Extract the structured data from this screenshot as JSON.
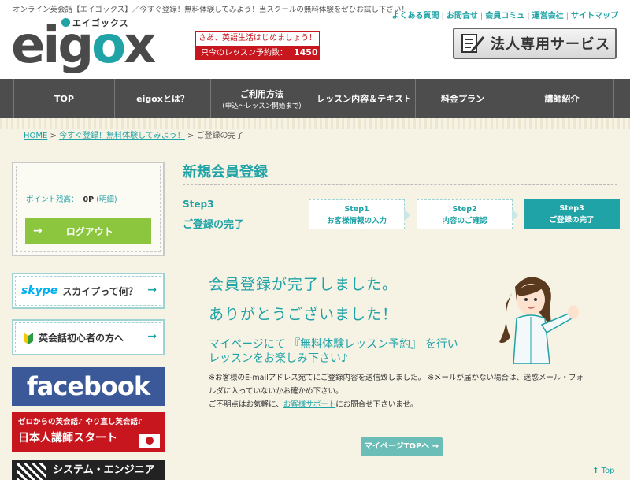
{
  "header": {
    "tagline": "オンライン英会話【エイゴックス】／今すぐ登録！無料体験してみよう！当スクールの無料体験をぜひお試し下さい！",
    "logo_kana": "エイゴックス",
    "logo_word_pre": "e",
    "logo_word_mid": "ig",
    "logo_word_go": "o",
    "logo_word_post": "x",
    "promo_top": "さあ、英語生活はじめましょう！",
    "promo_bottom_label": "只今のレッスン予約数：",
    "promo_bottom_count": "1450",
    "toplinks": [
      "よくある質問",
      "お問合せ",
      "会員コミュ",
      "運営会社",
      "サイトマップ"
    ],
    "corp_button": "法人専用サービス"
  },
  "nav": [
    {
      "label": "TOP",
      "sub": ""
    },
    {
      "label": "eigoxとは？",
      "sub": ""
    },
    {
      "label": "ご利用方法",
      "sub": "(申込～レッスン開始まで)"
    },
    {
      "label": "レッスン内容＆テキスト",
      "sub": ""
    },
    {
      "label": "料金プラン",
      "sub": ""
    },
    {
      "label": "講師紹介",
      "sub": ""
    }
  ],
  "breadcrumb": {
    "home": "HOME",
    "sep1": " > ",
    "register": "今すぐ登録！無料体験してみよう！",
    "sep2": " > ",
    "current": "ご登録の完了"
  },
  "sidebar": {
    "point_label": "ポイント残高：",
    "point_value": "0P",
    "point_detail_open": "(",
    "point_detail_link": "明細",
    "point_detail_close": ")",
    "logout": "ログアウト",
    "skype_logo": "skype",
    "skype_text": "スカイプって何？",
    "beginner_text": "英会話初心者の方へ",
    "facebook": "facebook",
    "jp_line1": "ゼロからの英会話♪ やり直し英会話♪",
    "jp_line2": "日本人講師スタート",
    "engineer": "システム・エンジニア"
  },
  "main": {
    "title": "新規会員登録",
    "step_label": "Step3",
    "step_title": "ご登録の完了",
    "steps": [
      {
        "num": "Step1",
        "label": "お客様情報の入力"
      },
      {
        "num": "Step2",
        "label": "内容のご確認"
      },
      {
        "num": "Step3",
        "label": "ご登録の完了"
      }
    ],
    "msg1": "会員登録が完了しました。",
    "msg2": "ありがとうございました！",
    "msg3": "マイページにて 『無料体験レッスン予約』 を行い",
    "msg4": "レッスンをお楽しみ下さい♪",
    "note1": "※お客様のE-mailアドレス宛てにご登録内容を送信致しました。 ※メールが届かない場合は、迷惑メール・フォ",
    "note2": "ルダに入っていないかお確かめ下さい。",
    "note3_pre": "ご不明点はお気軽に、",
    "note3_link": "お客様サポート",
    "note3_post": "にお問合せ下さいませ。",
    "mypage_button": "マイページTOPへ →",
    "pagetop": "Top"
  },
  "colors": {
    "accent": "#1fa3a6",
    "nav_bg": "#4d4d4d",
    "logout_green": "#8cc63f",
    "red": "#c7161d",
    "facebook_blue": "#3b5998"
  }
}
